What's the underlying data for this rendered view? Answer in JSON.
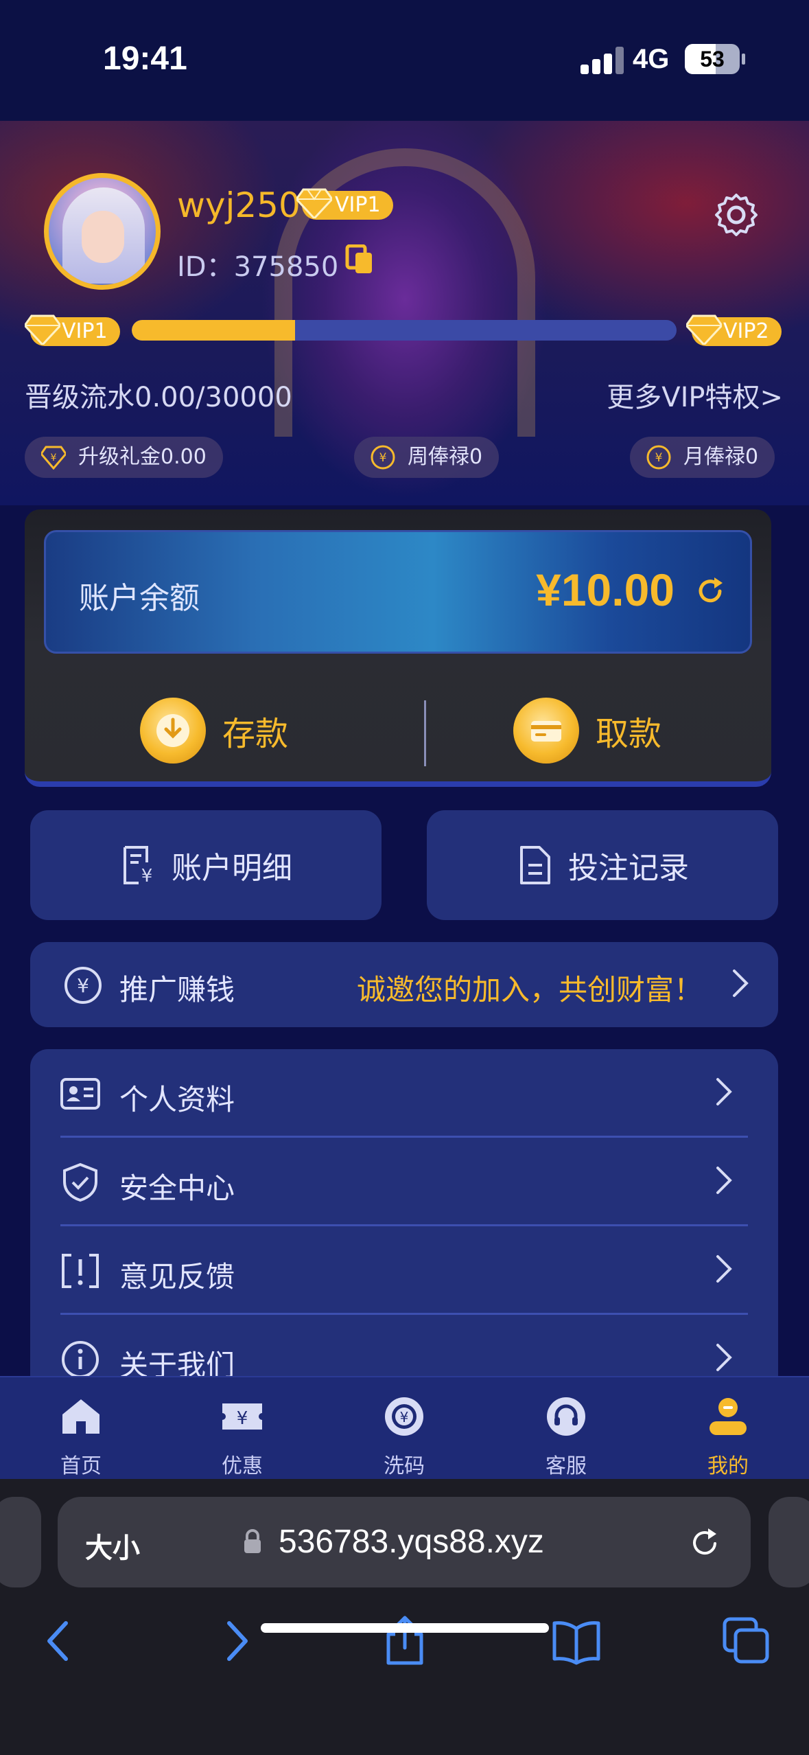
{
  "status_bar": {
    "time": "19:41",
    "network": "4G",
    "battery": "53"
  },
  "profile": {
    "username": "wyj250",
    "vip_badge": "VIP1",
    "id_text": "ID：375850"
  },
  "vip_progress": {
    "current_level": "VIP1",
    "next_level": "VIP2",
    "progress_fraction": 0.3,
    "flow_text": "晋级流水0.00/30000",
    "more_link": "更多VIP特权>"
  },
  "rewards": [
    {
      "label": "升级礼金0.00"
    },
    {
      "label": "周俸禄0"
    },
    {
      "label": "月俸禄0"
    }
  ],
  "balance": {
    "label": "账户余额",
    "value": "¥10.00",
    "deposit_label": "存款",
    "withdraw_label": "取款"
  },
  "tiles": [
    {
      "label": "账户明细"
    },
    {
      "label": "投注记录"
    }
  ],
  "promo": {
    "label": "推广赚钱",
    "slogan": "诚邀您的加入，共创财富！"
  },
  "menu": [
    {
      "label": "个人资料"
    },
    {
      "label": "安全中心"
    },
    {
      "label": "意见反馈"
    },
    {
      "label": "关于我们"
    }
  ],
  "tabbar": [
    {
      "label": "首页"
    },
    {
      "label": "优惠"
    },
    {
      "label": "洗码"
    },
    {
      "label": "客服"
    },
    {
      "label": "我的"
    }
  ],
  "browser": {
    "text_size_label": "大小",
    "url": "536783.yqs88.xyz"
  },
  "colors": {
    "accent": "#f7ba2c",
    "card": "#23307a",
    "background": "#0c0f48"
  }
}
